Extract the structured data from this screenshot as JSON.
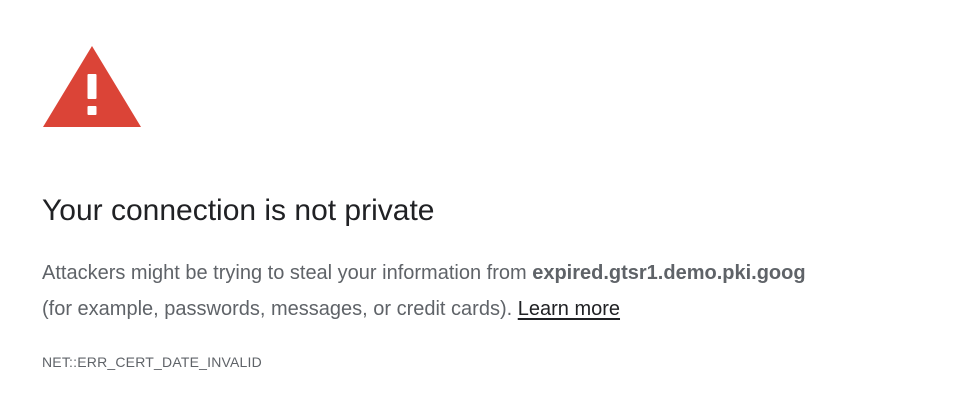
{
  "icon": {
    "name": "warning-triangle-icon",
    "color": "#db4437",
    "mark_color": "#ffffff"
  },
  "heading": "Your connection is not private",
  "message": {
    "prefix": "Attackers might be trying to steal your information from ",
    "hostname": "expired.gtsr1.demo.pki.goog",
    "suffix": "(for example, passwords, messages, or credit cards).",
    "learn_more": "Learn more"
  },
  "error_code": "NET::ERR_CERT_DATE_INVALID",
  "colors": {
    "heading": "#202124",
    "body_text": "#5f6368",
    "background": "#ffffff"
  }
}
